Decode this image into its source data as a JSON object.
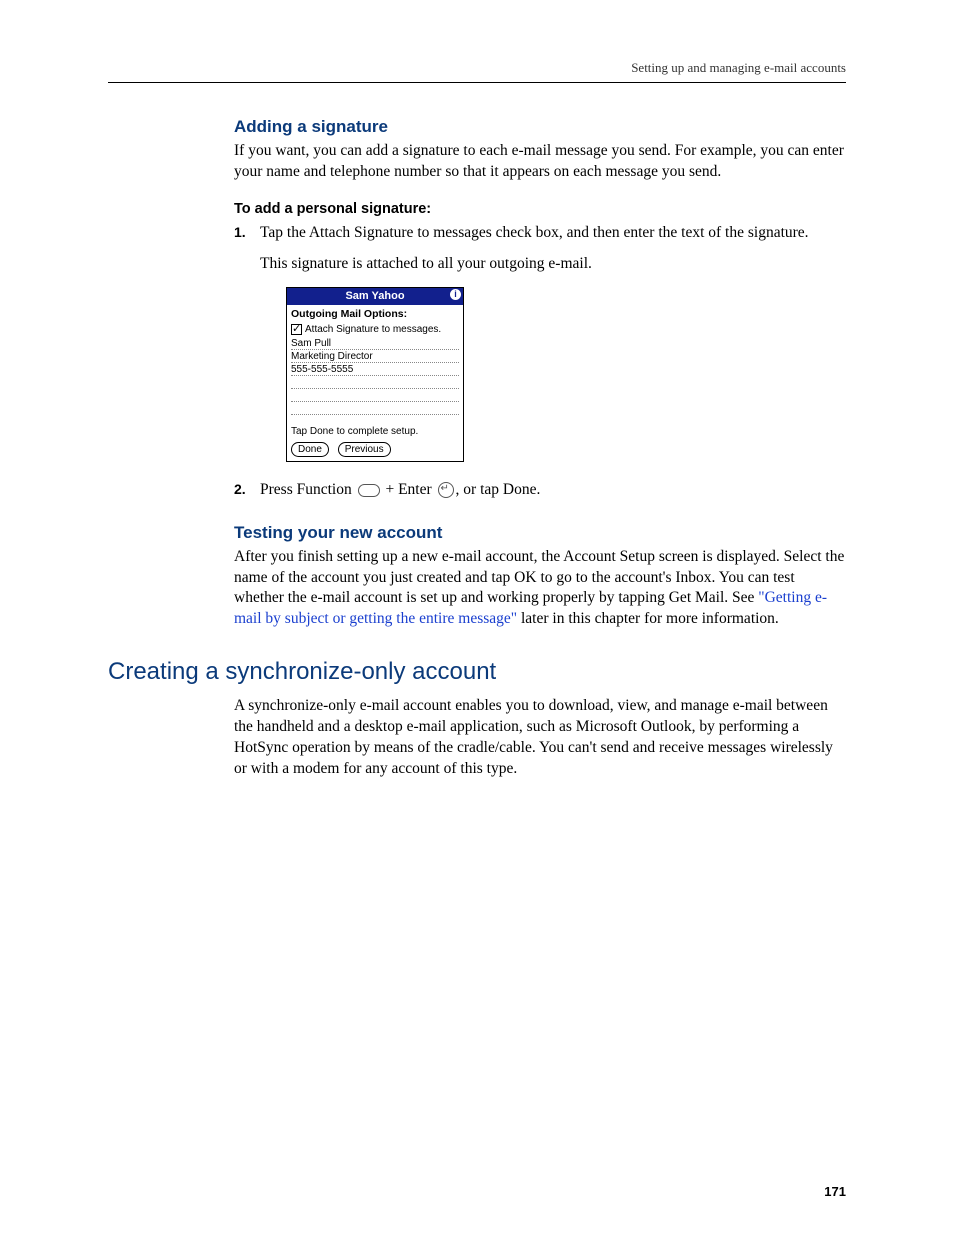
{
  "header": {
    "running_title": "Setting up and managing e-mail accounts"
  },
  "sec_signature": {
    "heading": "Adding a signature",
    "intro": "If you want, you can add a signature to each e-mail message you send. For example, you can enter your name and telephone number so that it appears on each message you send.",
    "howto_heading": "To add a personal signature:",
    "step1": "Tap the Attach Signature to messages check box, and then enter the text of the signature.",
    "step1_sub": "This signature is attached to all your outgoing e-mail.",
    "step2_pre": "Press Function ",
    "step2_mid": " + Enter ",
    "step2_post": ", or tap Done."
  },
  "palm": {
    "title": "Sam Yahoo",
    "heading": "Outgoing Mail Options:",
    "checkbox_label": "Attach Signature to messages.",
    "lines": [
      "Sam Pull",
      "Marketing Director",
      "555-555-5555",
      "",
      "",
      ""
    ],
    "hint": "Tap Done to complete setup.",
    "btn_done": "Done",
    "btn_prev": "Previous"
  },
  "sec_testing": {
    "heading": "Testing your new account",
    "body_pre": "After you finish setting up a new e-mail account, the Account Setup screen is displayed. Select the name of the account you just created and tap OK to go to the account's Inbox. You can test whether the e-mail account is set up and working properly by tapping Get Mail. See ",
    "link": "\"Getting e-mail by subject or getting the entire message\"",
    "body_post": " later in this chapter for more information."
  },
  "sec_sync": {
    "heading": "Creating a synchronize-only account",
    "body": "A synchronize-only e-mail account enables you to download, view, and manage e-mail between the handheld and a desktop e-mail application, such as Microsoft Outlook, by performing a HotSync operation by means of the cradle/cable. You can't send and receive messages wirelessly or with a modem for any account of this type."
  },
  "footer": {
    "page_number": "171"
  }
}
